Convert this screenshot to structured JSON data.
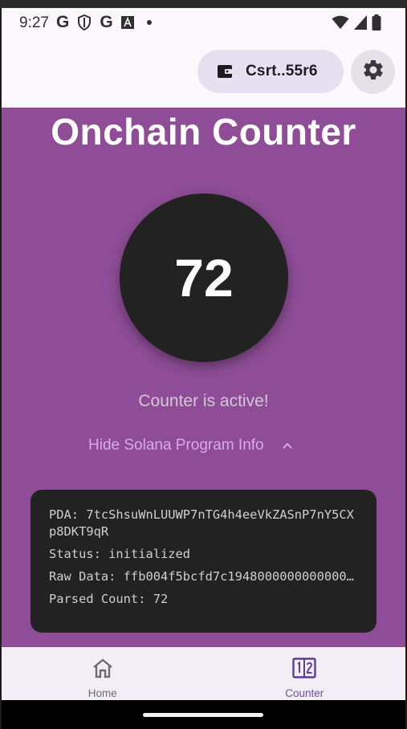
{
  "status_bar": {
    "time": "9:27",
    "left_icons": [
      "google-icon",
      "shield-icon",
      "google-icon",
      "font-a-icon",
      "dot-icon"
    ],
    "google_glyph": "G",
    "right_icons": [
      "wifi-icon",
      "signal-icon",
      "battery-icon"
    ]
  },
  "app_bar": {
    "wallet_label": "Csrt..55r6",
    "wallet_icon": "wallet-icon",
    "settings_icon": "gear-icon"
  },
  "main": {
    "title": "Onchain Counter",
    "counter_value": "72",
    "counter_status": "Counter is active!",
    "toggle_label": "Hide Solana Program Info",
    "info_lines": [
      "PDA: 7tcShsuWnLUUWP7nTG4h4eeVkZASnP7nY5CXp8DKT9qR",
      "Status: initialized",
      "Raw Data: ffb004f5bcfd7c1948000000000000…",
      "Parsed Count: 72"
    ]
  },
  "bottom_nav": {
    "items": [
      {
        "label": "Home",
        "icon": "home-icon"
      },
      {
        "label": "Counter",
        "icon": "counter-icon"
      }
    ],
    "selected": "Counter"
  },
  "colors": {
    "content_bg": "#8e4d96",
    "circle_bg": "#222222",
    "wallet_bg": "#e7e0f1",
    "toggle_text": "#d9a8ee",
    "nav_selected": "#6a4fa8"
  }
}
